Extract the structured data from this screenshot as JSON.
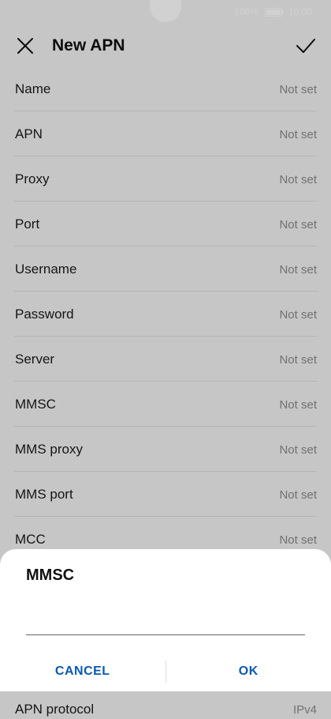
{
  "status": {
    "battery_text": "100%",
    "battery_level": 1.0,
    "time": "10:00"
  },
  "header": {
    "title": "New APN",
    "close_icon": "close-icon",
    "confirm_icon": "check-icon"
  },
  "fields": [
    {
      "label": "Name",
      "value": "Not set"
    },
    {
      "label": "APN",
      "value": "Not set"
    },
    {
      "label": "Proxy",
      "value": "Not set"
    },
    {
      "label": "Port",
      "value": "Not set"
    },
    {
      "label": "Username",
      "value": "Not set"
    },
    {
      "label": "Password",
      "value": "Not set"
    },
    {
      "label": "Server",
      "value": "Not set"
    },
    {
      "label": "MMSC",
      "value": "Not set"
    },
    {
      "label": "MMS proxy",
      "value": "Not set"
    },
    {
      "label": "MMS port",
      "value": "Not set"
    },
    {
      "label": "MCC",
      "value": "Not set"
    }
  ],
  "bottom_field": {
    "label": "APN protocol",
    "value": "IPv4"
  },
  "dialog": {
    "title": "MMSC",
    "input_value": "",
    "cancel_label": "CANCEL",
    "ok_label": "OK"
  },
  "colors": {
    "accent": "#0a59b0",
    "secondary_text": "#8a8a8a"
  }
}
